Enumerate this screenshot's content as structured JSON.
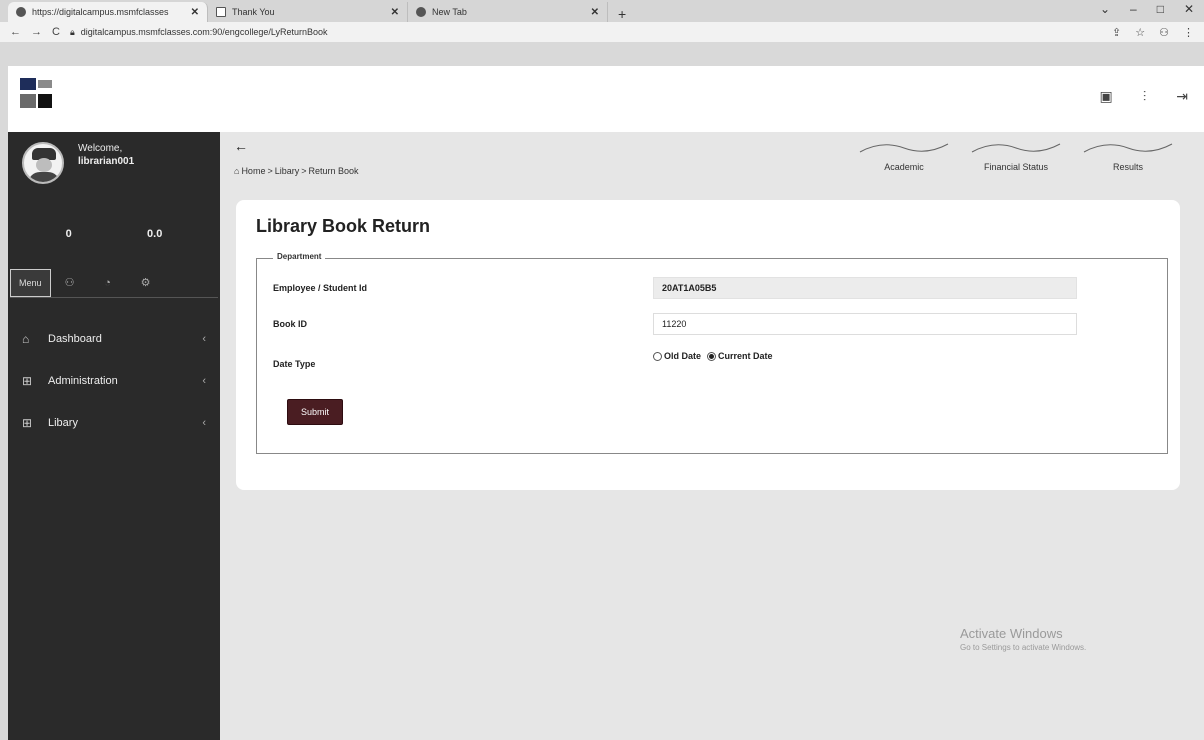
{
  "browser": {
    "tabs": [
      {
        "title": "https://digitalcampus.msmfclasses",
        "close": "✕",
        "icon": "globe-icon"
      },
      {
        "title": "Thank You",
        "close": "✕",
        "icon": "page-icon"
      },
      {
        "title": "New Tab",
        "close": "✕",
        "icon": "globe-icon"
      }
    ],
    "new_tab": "+",
    "url": "digitalcampus.msmfclasses.com:90/engcollege/LyReturnBook"
  },
  "sidebar": {
    "welcome": "Welcome,",
    "username": "librarian001",
    "stat_left": "0",
    "stat_right": "0.0",
    "menu_tab": "Menu",
    "nav_items": [
      {
        "label": "Dashboard",
        "icon": "home-icon"
      },
      {
        "label": "Administration",
        "icon": "grid-icon"
      },
      {
        "label": "Libary",
        "icon": "library-icon"
      }
    ]
  },
  "breadcrumb": {
    "home": "Home",
    "sep1": ">",
    "section": "Libary",
    "sep2": ">",
    "page": "Return Book"
  },
  "topnav": {
    "items": [
      "Academic",
      "Financial Status",
      "Results"
    ]
  },
  "form": {
    "title": "Library Book Return",
    "legend": "Department",
    "employee_label": "Employee / Student Id",
    "employee_value": "20AT1A05B5",
    "book_label": "Book ID",
    "book_value": "11220",
    "date_label": "Date Type",
    "radio_old": "Old Date",
    "radio_current": "Current Date",
    "selected_date_type": "Current Date",
    "submit": "Submit"
  },
  "watermark": {
    "line1": "Activate Windows",
    "line2": "Go to Settings to activate Windows."
  },
  "colors": {
    "sidebar_bg": "#2a2a2a",
    "submit_bg": "#4a1d22",
    "page_bg": "#e6e6e6"
  }
}
